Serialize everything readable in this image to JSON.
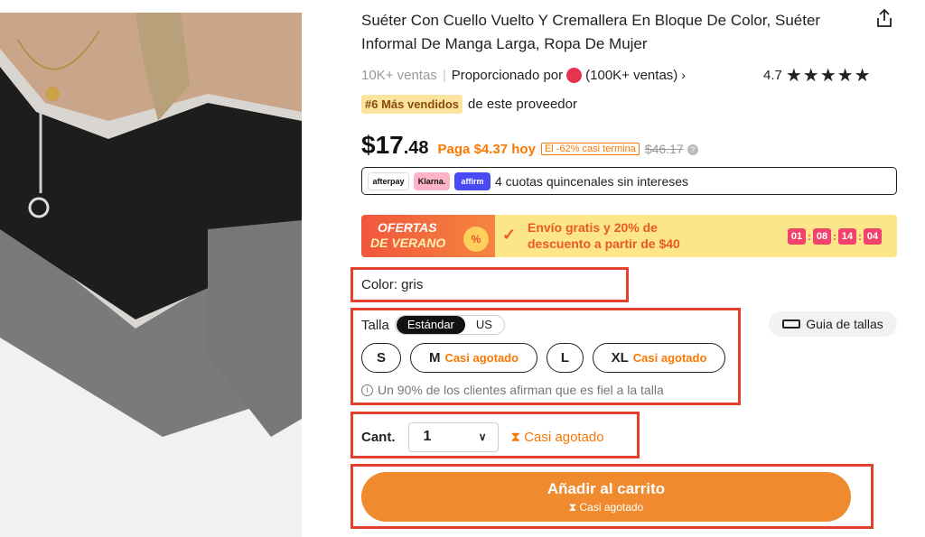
{
  "product": {
    "title": "Suéter Con Cuello Vuelto Y Cremallera En Bloque De Color, Suéter Informal De Manga Larga, Ropa De Mujer",
    "sales": "10K+ ventas",
    "provided_by": "Proporcionado por",
    "store_sales": "(100K+ ventas)",
    "rating": "4.7",
    "stars": "★★★★★",
    "bestseller_badge": "#6 Más vendidos",
    "bestseller_text": "de este proveedor"
  },
  "price": {
    "currency": "$",
    "whole": "17",
    "cents": ".48",
    "pay_today": "Paga $4.37 hoy",
    "discount": "El -62% casi termina",
    "original": "$46.17"
  },
  "installments": {
    "afterpay": "afterpay",
    "klarna": "Klarna.",
    "affirm": "affirm",
    "text": "4 cuotas quincenales sin intereses"
  },
  "promo": {
    "line1": "OFERTAS",
    "line2": "DE VERANO",
    "pct": "%",
    "text": "Envío gratis y 20% de descuento a partir de $40",
    "timer": [
      "01",
      "08",
      "14",
      "04"
    ]
  },
  "color": {
    "label": "Color: gris"
  },
  "size": {
    "label": "Talla",
    "standard": "Estándar",
    "us": "US",
    "guide": "Guia de tallas",
    "options": [
      {
        "name": "S",
        "status": ""
      },
      {
        "name": "M",
        "status": "Casi agotado"
      },
      {
        "name": "L",
        "status": ""
      },
      {
        "name": "XL",
        "status": "Casi agotado"
      }
    ],
    "fit_text": "Un 90% de los clientes afirman que es fiel a la talla"
  },
  "quantity": {
    "label": "Cant.",
    "value": "1",
    "status": "Casi agotado"
  },
  "cart": {
    "label": "Añadir al carrito",
    "sub": "Casi agotado"
  },
  "colors": {
    "accent": "#fb7701",
    "highlight": "#e2412d",
    "cart_button": "#f08a2e"
  }
}
